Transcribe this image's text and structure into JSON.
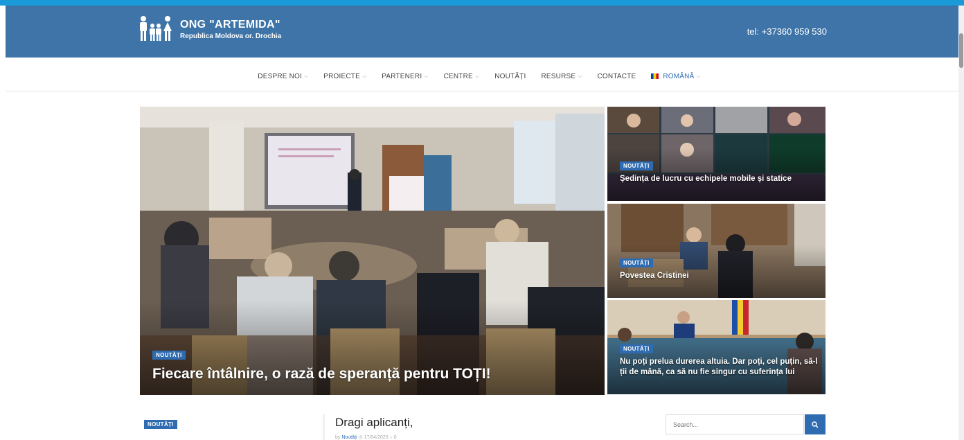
{
  "header": {
    "logo_title": "ONG \"ARTEMIDA\"",
    "logo_subtitle": "Republica Moldova or. Drochia",
    "phone": "tel: +37360 959 530"
  },
  "nav": {
    "items": [
      {
        "label": "DESPRE NOI",
        "caret": true
      },
      {
        "label": "PROIECTE",
        "caret": true
      },
      {
        "label": "PARTENERI",
        "caret": true
      },
      {
        "label": "CENTRE",
        "caret": true
      },
      {
        "label": "NOUTĂȚI",
        "caret": false
      },
      {
        "label": "RESURSE",
        "caret": true
      },
      {
        "label": "CONTACTE",
        "caret": false
      }
    ],
    "language": "ROMÂNĂ"
  },
  "featured": {
    "main": {
      "category": "NOUTĂȚI",
      "title": "Fiecare întâlnire, o rază de speranță pentru TOȚI!"
    },
    "side": [
      {
        "category": "NOUTĂȚI",
        "title": "Ședința de lucru cu echipele mobile și statice"
      },
      {
        "category": "NOUTĂȚI",
        "title": "Povestea Cristinei"
      },
      {
        "category": "NOUTĂȚI",
        "title": "Nu poți prelua durerea altuia. Dar poți, cel puțin, să-l ții de mână, ca să nu fie singur cu suferința lui"
      }
    ]
  },
  "latest": {
    "category": "NOUTĂȚI",
    "post_title": "Dragi aplicanți,",
    "meta_author": "Noutăți",
    "meta_date": "17/04/2025"
  },
  "search": {
    "placeholder": "Search..."
  },
  "colors": {
    "header": "#3f74a8",
    "topbar": "#1a9ad8",
    "accent": "#2e6bb1"
  }
}
